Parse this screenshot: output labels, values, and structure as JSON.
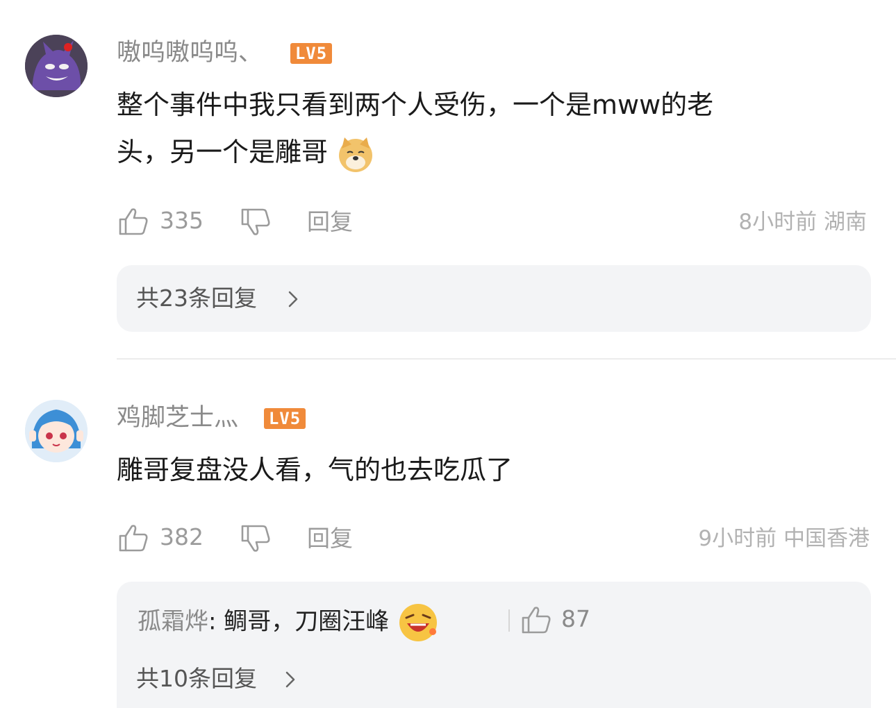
{
  "comments": [
    {
      "username": "嗷呜嗷呜呜、",
      "level": "LV5",
      "text_line1": "整个事件中我只看到两个人受伤，一个是mww的老",
      "text_line2": "头，另一个是雕哥",
      "emoji": "doge-emoji",
      "likes": "335",
      "reply_label": "回复",
      "time": "8小时前",
      "location": "湖南",
      "reply_summary": "共23条回复"
    },
    {
      "username": "鸡脚芝士灬",
      "level": "LV5",
      "text_line1": "雕哥复盘没人看，气的也去吃瓜了",
      "likes": "382",
      "reply_label": "回复",
      "time": "9小时前",
      "location": "中国香港",
      "sub_reply": {
        "name": "孤霜烨",
        "text": ": 鲷哥，刀圈汪峰",
        "emoji": "laugh-emoji",
        "likes": "87"
      },
      "reply_summary": "共10条回复"
    }
  ],
  "colors": {
    "level_badge": "#f08a3a",
    "reply_box_bg": "#f3f4f6"
  }
}
